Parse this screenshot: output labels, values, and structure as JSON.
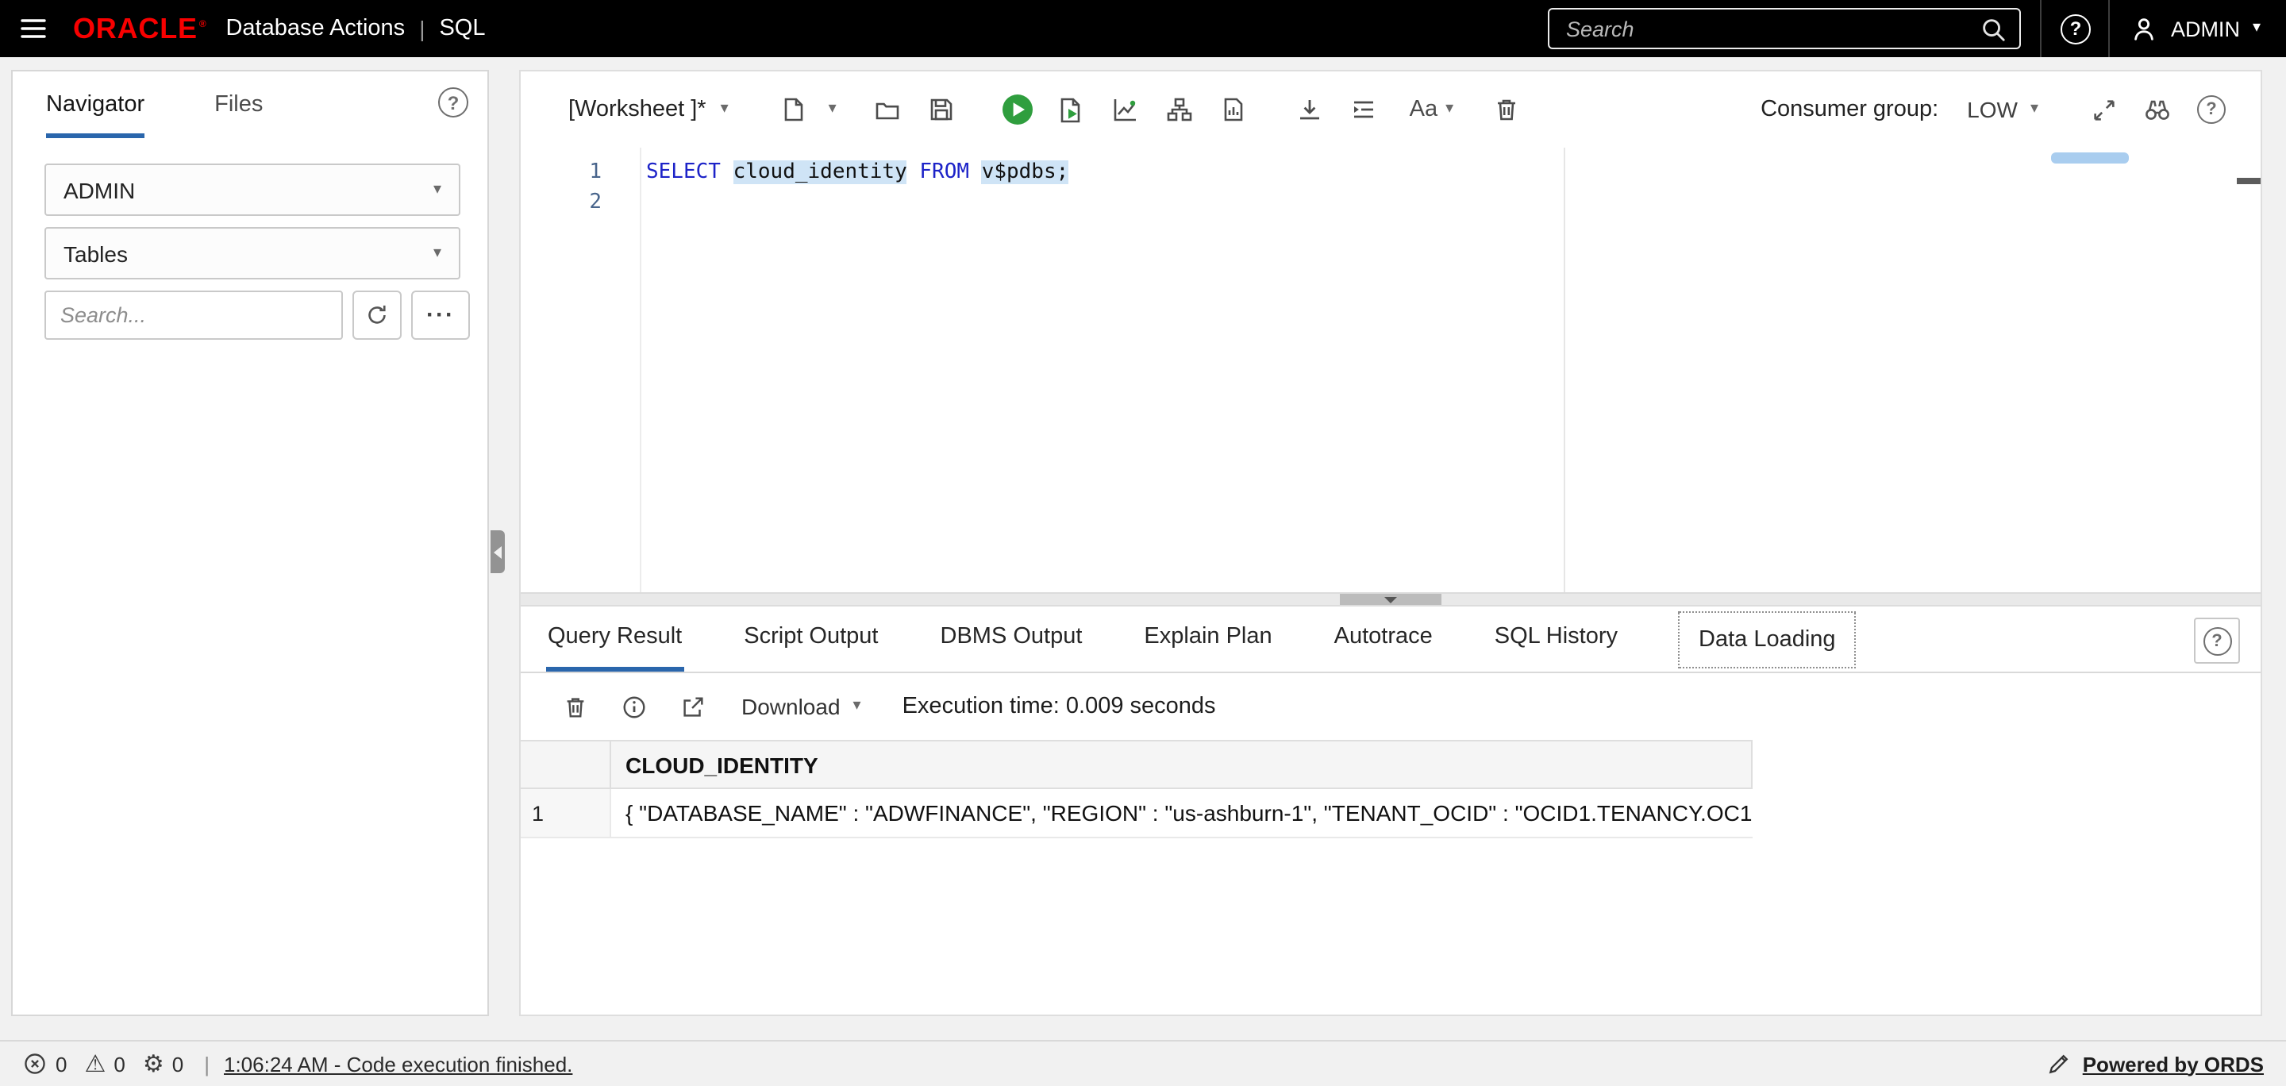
{
  "header": {
    "brand": "ORACLE",
    "title": "Database Actions",
    "divider": "|",
    "section": "SQL",
    "search_placeholder": "Search",
    "user_label": "ADMIN"
  },
  "sidebar": {
    "tabs": [
      {
        "label": "Navigator"
      },
      {
        "label": "Files"
      }
    ],
    "schema_value": "ADMIN",
    "type_value": "Tables",
    "search_placeholder": "Search..."
  },
  "worksheet": {
    "title": "[Worksheet ]*",
    "font_label": "Aa",
    "consumer_group_label": "Consumer group:",
    "consumer_group_value": "LOW",
    "editor": {
      "line_numbers": [
        "1",
        "2"
      ],
      "code": {
        "kw1": "SELECT ",
        "id1": "cloud_identity",
        "kw2": " FROM ",
        "id2": "v$pdbs;"
      }
    }
  },
  "results": {
    "tabs": [
      "Query Result",
      "Script Output",
      "DBMS Output",
      "Explain Plan",
      "Autotrace",
      "SQL History",
      "Data Loading"
    ],
    "download_label": "Download",
    "execution_time": "Execution time: 0.009 seconds",
    "table": {
      "column": "CLOUD_IDENTITY",
      "row_num": "1",
      "row_value": "{ \"DATABASE_NAME\" : \"ADWFINANCE\", \"REGION\" : \"us-ashburn-1\", \"TENANT_OCID\" : \"OCID1.TENANCY.OC1"
    }
  },
  "statusbar": {
    "error_count": "0",
    "warning_count": "0",
    "process_count": "0",
    "separator": "|",
    "message": "1:06:24 AM - Code execution finished.",
    "powered_by": "Powered by ORDS"
  },
  "colors": {
    "accent_blue": "#2a66ac",
    "run_green": "#2f9e3e",
    "oracle_red": "#f80000",
    "keyword_blue": "#1d23c8",
    "highlight_bg": "#cfe4f6"
  }
}
